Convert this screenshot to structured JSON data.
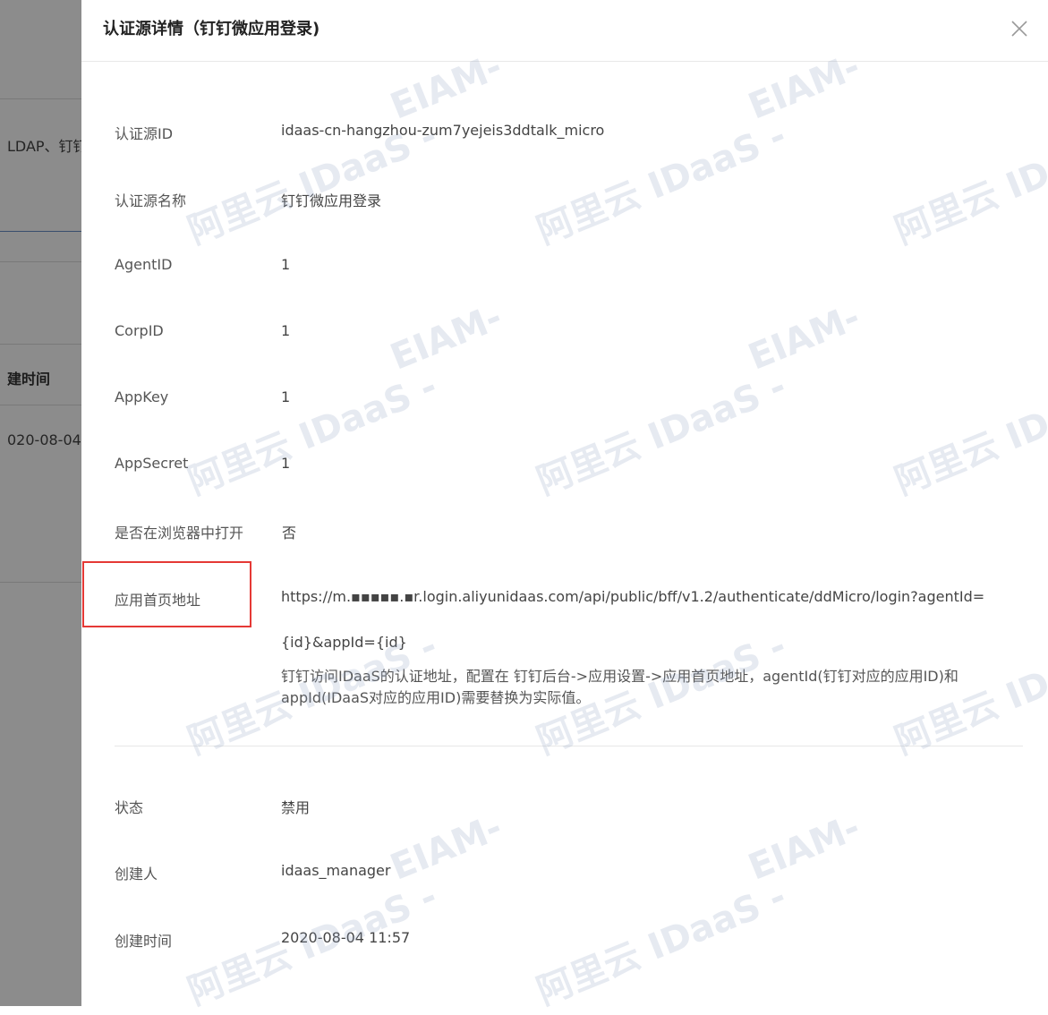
{
  "background": {
    "filter_text": "LDAP、钉钉",
    "column_header": "建时间",
    "cell_date": "020-08-04"
  },
  "drawer": {
    "title": "认证源详情（钉钉微应用登录)",
    "fields": [
      {
        "label": "认证源ID",
        "value": "idaas-cn-hangzhou-zum7yejeis3ddtalk_micro"
      },
      {
        "label": "认证源名称",
        "value": "钉钉微应用登录"
      },
      {
        "label": "AgentID",
        "value": "1"
      },
      {
        "label": "CorpID",
        "value": "1"
      },
      {
        "label": "AppKey",
        "value": "1"
      },
      {
        "label": "AppSecret",
        "value": "1"
      },
      {
        "label": "是否在浏览器中打开",
        "value": "否"
      }
    ],
    "homepage": {
      "label": "应用首页地址",
      "url_line1": "https://m.▪▪▪▪▪.▪r.login.aliyunidaas.com/api/public/bff/v1.2/authenticate/ddMicro/login?agentId=",
      "url_line2": "{id}&appId={id}",
      "help": "钉钉访问IDaaS的认证地址，配置在 钉钉后台->应用设置->应用首页地址，agentId(钉钉对应的应用ID)和appId(IDaaS对应的应用ID)需要替换为实际值。"
    },
    "status_fields": [
      {
        "label": "状态",
        "value": "禁用"
      },
      {
        "label": "创建人",
        "value": "idaas_manager"
      },
      {
        "label": "创建时间",
        "value": "2020-08-04 11:57"
      }
    ]
  },
  "watermark": {
    "line1": "EIAM-",
    "line2": "阿里云 IDaaS -"
  },
  "colors": {
    "overlay": "#5a5a5a",
    "highlight": "#e53935",
    "divider": "#e8e8e8"
  }
}
